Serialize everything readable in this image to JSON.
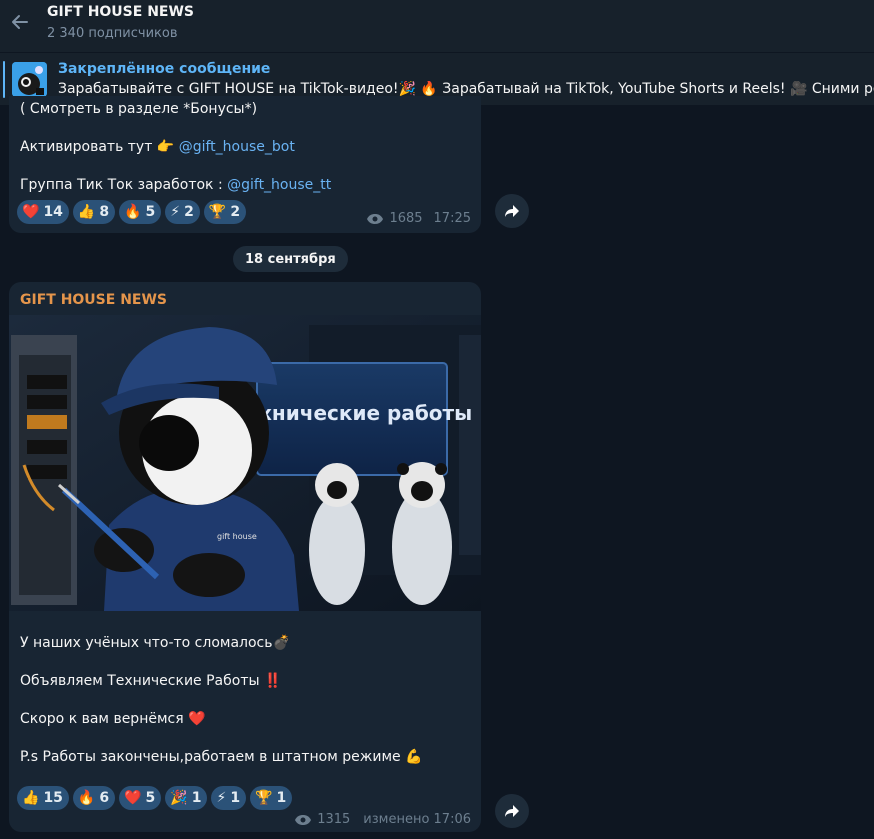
{
  "header": {
    "title": "GIFT HOUSE NEWS",
    "subscribers": "2 340 подписчиков"
  },
  "pinned": {
    "title": "Закреплённое сообщение",
    "text": "Зарабатывайте с GIFT HOUSE на TikTok-видео!🎉  🔥 Зарабатывай на TikTok, YouTube Shorts и Reels! 🎥 Сними ролик"
  },
  "message1": {
    "line_bonus": "( Смотреть в разделе *Бонусы*)",
    "activate_text": "Активировать тут 👉 ",
    "activate_link": "@gift_house_bot",
    "group_text": "Группа Тик Ток заработок : ",
    "group_link": "@gift_house_tt",
    "reactions": [
      {
        "emoji": "❤️",
        "count": "14"
      },
      {
        "emoji": "👍",
        "count": "8"
      },
      {
        "emoji": "🔥",
        "count": "5"
      },
      {
        "emoji": "⚡",
        "count": "2"
      },
      {
        "emoji": "🏆",
        "count": "2"
      }
    ],
    "views": "1685",
    "time": "17:25"
  },
  "date_separator": "18 сентября",
  "message2": {
    "sender": "GIFT HOUSE NEWS",
    "photo_caption": "Технические работы",
    "photo_shirt_text": "gift house",
    "lines": [
      "У наших учёных что-то сломалось💣",
      "Объявляем Технические Работы ‼️",
      "Скоро к вам вернёмся ❤️",
      "P.s Работы закончены,работаем в штатном режиме 💪"
    ],
    "reactions": [
      {
        "emoji": "👍",
        "count": "15"
      },
      {
        "emoji": "🔥",
        "count": "6"
      },
      {
        "emoji": "❤️",
        "count": "5"
      },
      {
        "emoji": "🎉",
        "count": "1"
      },
      {
        "emoji": "⚡",
        "count": "1"
      },
      {
        "emoji": "🏆",
        "count": "1"
      }
    ],
    "views": "1315",
    "edited_time": "изменено 17:06"
  },
  "colors": {
    "background": "#0e1621",
    "bubble": "#182533",
    "accent": "#5eb5f7",
    "sender": "#e5954b",
    "reaction_bg": "#2b5278"
  }
}
